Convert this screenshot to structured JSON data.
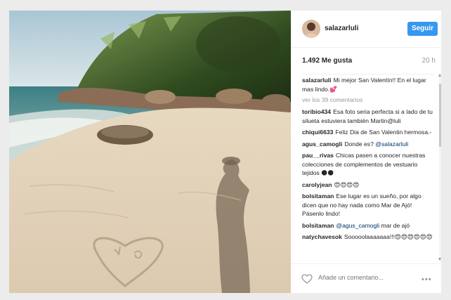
{
  "post": {
    "username": "salazarluli",
    "follow_label": "Seguir",
    "likes": "1.492 Me gusta",
    "time": "20 h"
  },
  "caption": {
    "user": "salazarluli",
    "text": "Mi mejor San Valentín!! En el lugar mas lindo.💕"
  },
  "view_more": "ver los 39 comentarios",
  "comments": [
    {
      "user": "toribio434",
      "text": "Esa foto seria perfecta si a lado de tu silueta estuviera también Martin@luli",
      "mention": ""
    },
    {
      "user": "chiqui6633",
      "text": "Feliz Dia de San Valentin hermosa.-",
      "mention": ""
    },
    {
      "user": "agus_camogli",
      "text": "Donde es?",
      "mention": "@salazarluli"
    },
    {
      "user": "pau__rivas",
      "text": "Chicas pasen a conocer nuestras colecciones de complementos de vestuario tejidos 🌑🌑",
      "mention": ""
    },
    {
      "user": "carolyjean",
      "text": "😍😍😍😍",
      "mention": ""
    },
    {
      "user": "bolsitaman",
      "text": "Ese lugar es un sueño, por algo dicen que no hay nada como Mar de Ajó! Pásenlo lindo!",
      "mention": ""
    },
    {
      "user": "bolsitaman",
      "text": "mar de ajó",
      "mention": "@agus_camogli"
    },
    {
      "user": "natychavesok",
      "text": "Sooooolaaaaaaa!!!😍😍😍😍😍😍",
      "mention": ""
    }
  ],
  "footer": {
    "placeholder": "Añade un comentario...",
    "more_icon": "ellipsis-icon"
  }
}
